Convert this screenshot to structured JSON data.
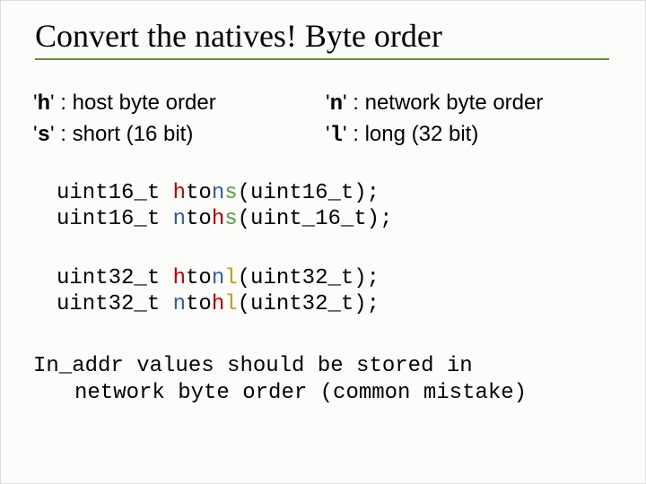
{
  "title": "Convert the natives! Byte order",
  "defs": {
    "h_key": "h",
    "h_text": " : host byte order",
    "n_key": "n",
    "n_text": " : network byte order",
    "s_key": "s",
    "s_text": " : short (16 bit)",
    "l_key": "l",
    "l_text": " : long (32 bit)"
  },
  "code": {
    "l1_ret": "uint16_t ",
    "l1_h": "h",
    "l1_to": "to",
    "l1_n": "n",
    "l1_s": "s",
    "l1_args": "(uint16_t);",
    "l2_ret": "uint16_t ",
    "l2_n": "n",
    "l2_to": "to",
    "l2_h": "h",
    "l2_s": "s",
    "l2_args": "(uint_16_t);",
    "l3_ret": "uint32_t ",
    "l3_h": "h",
    "l3_to": "to",
    "l3_n": "n",
    "l3_l": "l",
    "l3_args": "(uint32_t);",
    "l4_ret": "uint32_t ",
    "l4_n": "n",
    "l4_to": "to",
    "l4_h": "h",
    "l4_l": "l",
    "l4_args": "(uint32_t);"
  },
  "note": {
    "line1": "In_addr values should be stored in",
    "line2": "network byte order (common mistake)"
  }
}
